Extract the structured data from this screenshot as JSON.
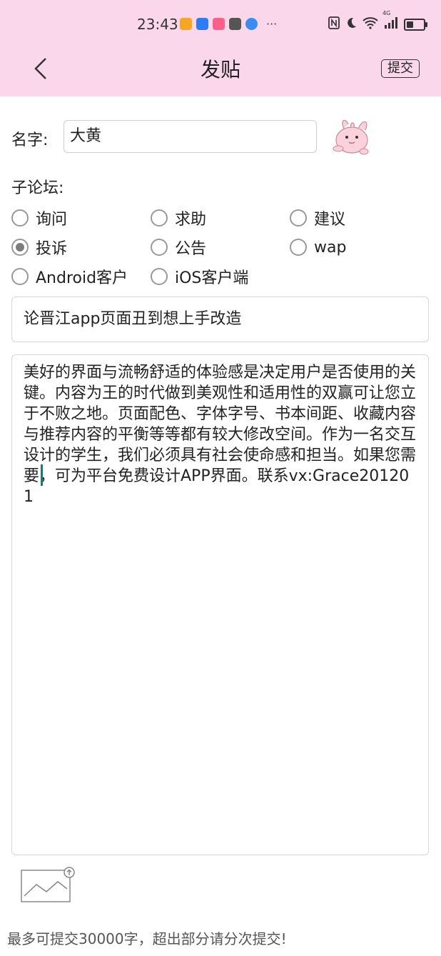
{
  "status_bar": {
    "time": "23:43",
    "app_icon_colors": [
      "#f5a623",
      "#2d7cf6",
      "#ff5d8a",
      "#555555",
      "#3b8cf0"
    ],
    "more": "···",
    "icons": [
      "nfc-icon",
      "moon-icon",
      "wifi-icon",
      "signal-icon",
      "battery-icon"
    ],
    "network": "4G"
  },
  "header": {
    "title": "发贴",
    "submit_label": "提交",
    "background": "#fad7ea"
  },
  "form": {
    "name_label": "名字:",
    "name_value": "大黄",
    "subforum_label": "子论坛:",
    "options": [
      {
        "label": "询问",
        "checked": false
      },
      {
        "label": "求助",
        "checked": false
      },
      {
        "label": "建议",
        "checked": false
      },
      {
        "label": "投诉",
        "checked": true
      },
      {
        "label": "公告",
        "checked": false
      },
      {
        "label": "wap",
        "checked": false
      },
      {
        "label": "Android客户",
        "checked": false
      },
      {
        "label": "iOS客户端",
        "checked": false
      }
    ],
    "title_value": "论晋江app页面丑到想上手改造",
    "content_value": "美好的界面与流畅舒适的体验感是决定用户是否使用的关键。内容为王的时代做到美观性和适用性的双赢可让您立于不败之地。页面配色、字体字号、书本间距、收藏内容与推荐内容的平衡等等都有较大修改空间。作为一名交互设计的学生，我们必须具有社会使命感和担当。如果您需要，可为平台免费设计APP界面。联系vx:Grace201201"
  },
  "footer": {
    "note": "最多可提交30000字，超出部分请分次提交!"
  }
}
